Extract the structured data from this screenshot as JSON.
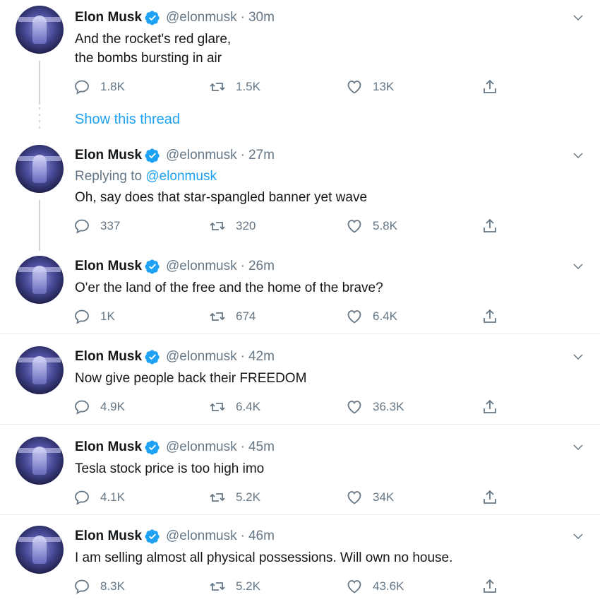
{
  "tweets": [
    {
      "name": "Elon Musk",
      "handle": "@elonmusk",
      "separator": "·",
      "time": "30m",
      "lines": [
        "And the rocket's red glare,",
        "the bombs bursting in air"
      ],
      "replies": "1.8K",
      "retweets": "1.5K",
      "likes": "13K"
    },
    {
      "name": "Elon Musk",
      "handle": "@elonmusk",
      "separator": "·",
      "time": "27m",
      "replying_prefix": "Replying to",
      "replying_to": "@elonmusk",
      "lines": [
        "Oh, say does that star-spangled banner yet wave"
      ],
      "replies": "337",
      "retweets": "320",
      "likes": "5.8K"
    },
    {
      "name": "Elon Musk",
      "handle": "@elonmusk",
      "separator": "·",
      "time": "26m",
      "lines": [
        "O'er the land of the free and the home of the brave?"
      ],
      "replies": "1K",
      "retweets": "674",
      "likes": "6.4K"
    },
    {
      "name": "Elon Musk",
      "handle": "@elonmusk",
      "separator": "·",
      "time": "42m",
      "lines": [
        "Now give people back their FREEDOM"
      ],
      "replies": "4.9K",
      "retweets": "6.4K",
      "likes": "36.3K"
    },
    {
      "name": "Elon Musk",
      "handle": "@elonmusk",
      "separator": "·",
      "time": "45m",
      "lines": [
        "Tesla stock price is too high imo"
      ],
      "replies": "4.1K",
      "retweets": "5.2K",
      "likes": "34K"
    },
    {
      "name": "Elon Musk",
      "handle": "@elonmusk",
      "separator": "·",
      "time": "46m",
      "lines": [
        "I am selling almost all physical possessions. Will own no house."
      ],
      "replies": "8.3K",
      "retweets": "5.2K",
      "likes": "43.6K"
    }
  ],
  "show_thread_label": "Show this thread",
  "icons": {
    "verified": "verified-badge-icon",
    "caret": "chevron-down-icon",
    "reply": "reply-icon",
    "retweet": "retweet-icon",
    "like": "heart-icon",
    "share": "share-icon"
  },
  "colors": {
    "accent": "#1da1f2",
    "muted": "#657786",
    "text": "#14171a",
    "divider": "#e6ecf0"
  }
}
